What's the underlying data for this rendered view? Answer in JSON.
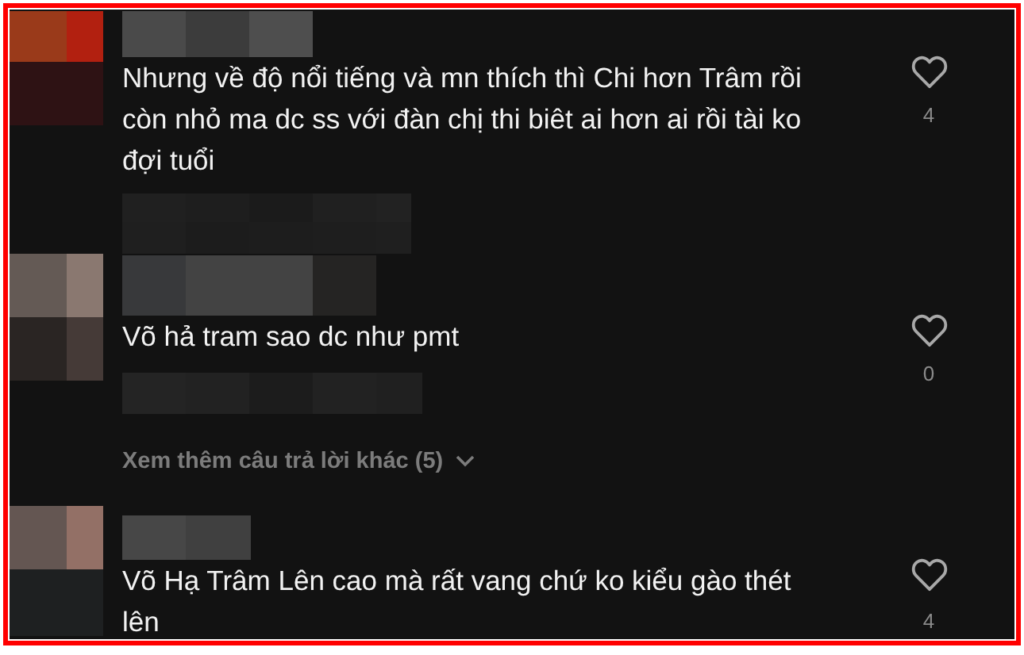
{
  "comments": [
    {
      "text": "Nhưng về độ nổi tiếng và mn thích thì Chi hơn Trâm rồi còn nhỏ ma dc ss với đàn chị thi biêt ai hơn ai rồi tài ko đợi tuổi",
      "likes": "4",
      "liked": false
    },
    {
      "text": "Võ hả tram sao dc như pmt",
      "likes": "0",
      "liked": false
    },
    {
      "text": "Võ Hạ Trâm Lên cao mà rất vang chứ ko kiểu gào thét lên",
      "likes": "4",
      "liked": false
    }
  ],
  "more_replies": {
    "label": "Xem thêm câu trả lời khác (5)",
    "expanded": false
  }
}
